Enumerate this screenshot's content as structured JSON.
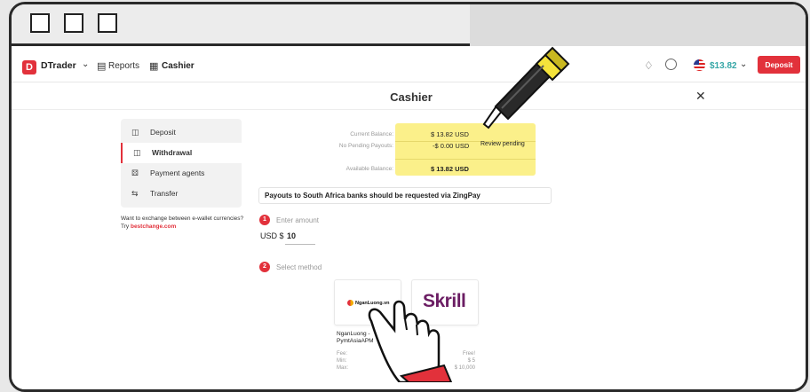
{
  "app": {
    "brand": "DTrader",
    "nav_reports": "Reports",
    "nav_cashier": "Cashier",
    "account_balance": "$13.82",
    "deposit_label": "Deposit"
  },
  "page": {
    "title": "Cashier"
  },
  "sidebar": {
    "items": [
      {
        "label": "Deposit",
        "icon": "deposit-icon"
      },
      {
        "label": "Withdrawal",
        "icon": "withdrawal-icon"
      },
      {
        "label": "Payment agents",
        "icon": "payment-agents-icon"
      },
      {
        "label": "Transfer",
        "icon": "transfer-icon"
      }
    ],
    "exchange_text": "Want to exchange between e-wallet currencies? Try",
    "exchange_link": "bestchange.com"
  },
  "balances": {
    "current_label": "Current Balance:",
    "current_value": "$ 13.82 USD",
    "pending_label": "No Pending Payouts:",
    "pending_value": "-$ 0.00 USD",
    "review_label": "Review pending",
    "available_label": "Available Balance:",
    "available_value": "$ 13.82 USD"
  },
  "notice": "Payouts to South Africa banks should be requested via ZingPay",
  "steps": {
    "one_num": "1",
    "one_label": "Enter amount",
    "currency": "USD $",
    "amount": "10",
    "two_num": "2",
    "two_label": "Select method"
  },
  "methods": [
    {
      "logo_text": "NganLuong.vn",
      "name_line1": "NganLuong -",
      "name_line2": "PymtAsiaAPM"
    },
    {
      "logo_text": "Skrill",
      "name_line1": "Skrill"
    }
  ],
  "fees": {
    "fee_label": "Fee:",
    "min_label": "Min:",
    "max_label": "Max:",
    "fee_value": "Free!",
    "min_value": "$ 5",
    "max_value": "$ 10,000"
  },
  "colors": {
    "accent": "#e2313b",
    "highlight": "#fbf08a",
    "balance_text": "#35a6a6",
    "skrill": "#6b1d63"
  }
}
